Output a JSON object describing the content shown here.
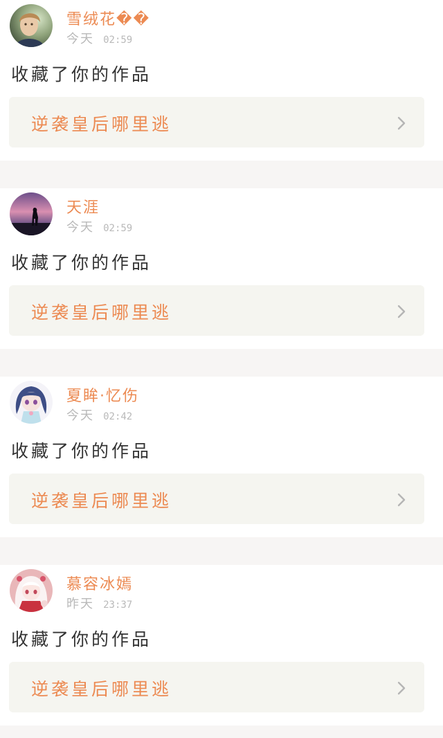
{
  "notifications": [
    {
      "avatar": "child-portrait-avatar",
      "username": "雪绒花��",
      "day": "今天",
      "time": "02:59",
      "action": "收藏了你的作品",
      "work_title": "逆袭皇后哪里逃",
      "chevron": "chevron-right-icon"
    },
    {
      "avatar": "sunset-silhouette-avatar",
      "username": "天涯",
      "day": "今天",
      "time": "02:59",
      "action": "收藏了你的作品",
      "work_title": "逆袭皇后哪里逃",
      "chevron": "chevron-right-icon"
    },
    {
      "avatar": "anime-girl-blue-avatar",
      "username": "夏眸·忆伤",
      "day": "今天",
      "time": "02:42",
      "action": "收藏了你的作品",
      "work_title": "逆袭皇后哪里逃",
      "chevron": "chevron-right-icon"
    },
    {
      "avatar": "anime-girl-pink-avatar",
      "username": "慕容冰嫣",
      "day": "昨天",
      "time": "23:37",
      "action": "收藏了你的作品",
      "work_title": "逆袭皇后哪里逃",
      "chevron": "chevron-right-icon"
    }
  ],
  "colors": {
    "accent": "#ec8a52",
    "muted": "#b9b9b9",
    "text": "#333333",
    "card_bg": "#f5f5f0",
    "divider": "#f7f5f4"
  }
}
